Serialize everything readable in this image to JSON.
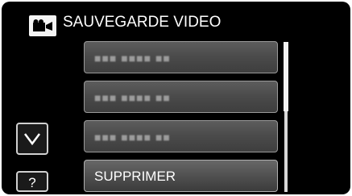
{
  "header": {
    "title": "SAUVEGARDE VIDEO",
    "icon": "video-camera-icon"
  },
  "menu": {
    "items": [
      {
        "label": "■■■ ■■■■ ■■",
        "state": "disabled"
      },
      {
        "label": "■■■ ■■■■ ■■",
        "state": "disabled"
      },
      {
        "label": "■■■ ■■■■ ■■",
        "state": "disabled"
      },
      {
        "label": "SUPPRIMER",
        "state": "enabled"
      }
    ]
  },
  "controls": {
    "down_icon": "chevron-down-icon",
    "help_label": "?"
  },
  "colors": {
    "background": "#000000",
    "item_fill": "#4a4a4a",
    "item_border": "#9a9a9a",
    "text": "#ffffff",
    "disabled_text": "#9c9c9c"
  },
  "scroll": {
    "position_fraction": 0.0,
    "visible_fraction": 0.46
  }
}
